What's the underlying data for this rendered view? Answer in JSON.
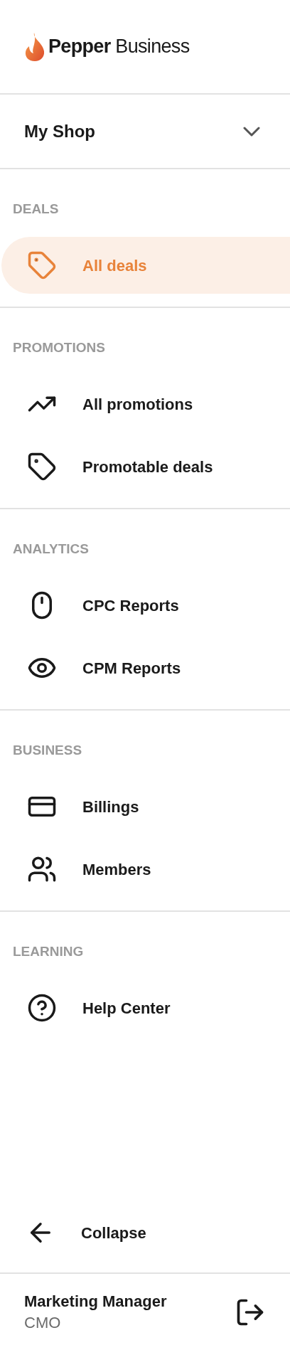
{
  "brand": {
    "name_bold": "Pepper",
    "name_light": "Business"
  },
  "shop_selector": {
    "label": "My Shop"
  },
  "sections": [
    {
      "label": "DEALS",
      "items": [
        {
          "label": "All deals",
          "selected": true
        }
      ]
    },
    {
      "label": "PROMOTIONS",
      "items": [
        {
          "label": "All promotions",
          "selected": false
        },
        {
          "label": "Promotable deals",
          "selected": false
        }
      ]
    },
    {
      "label": "ANALYTICS",
      "items": [
        {
          "label": "CPC Reports",
          "selected": false
        },
        {
          "label": "CPM Reports",
          "selected": false
        }
      ]
    },
    {
      "label": "BUSINESS",
      "items": [
        {
          "label": "Billings",
          "selected": false
        },
        {
          "label": "Members",
          "selected": false
        }
      ]
    },
    {
      "label": "LEARNING",
      "items": [
        {
          "label": "Help Center",
          "selected": false
        }
      ]
    }
  ],
  "collapse": {
    "label": "Collapse"
  },
  "user": {
    "name": "Marketing Manager",
    "role": "CMO"
  }
}
